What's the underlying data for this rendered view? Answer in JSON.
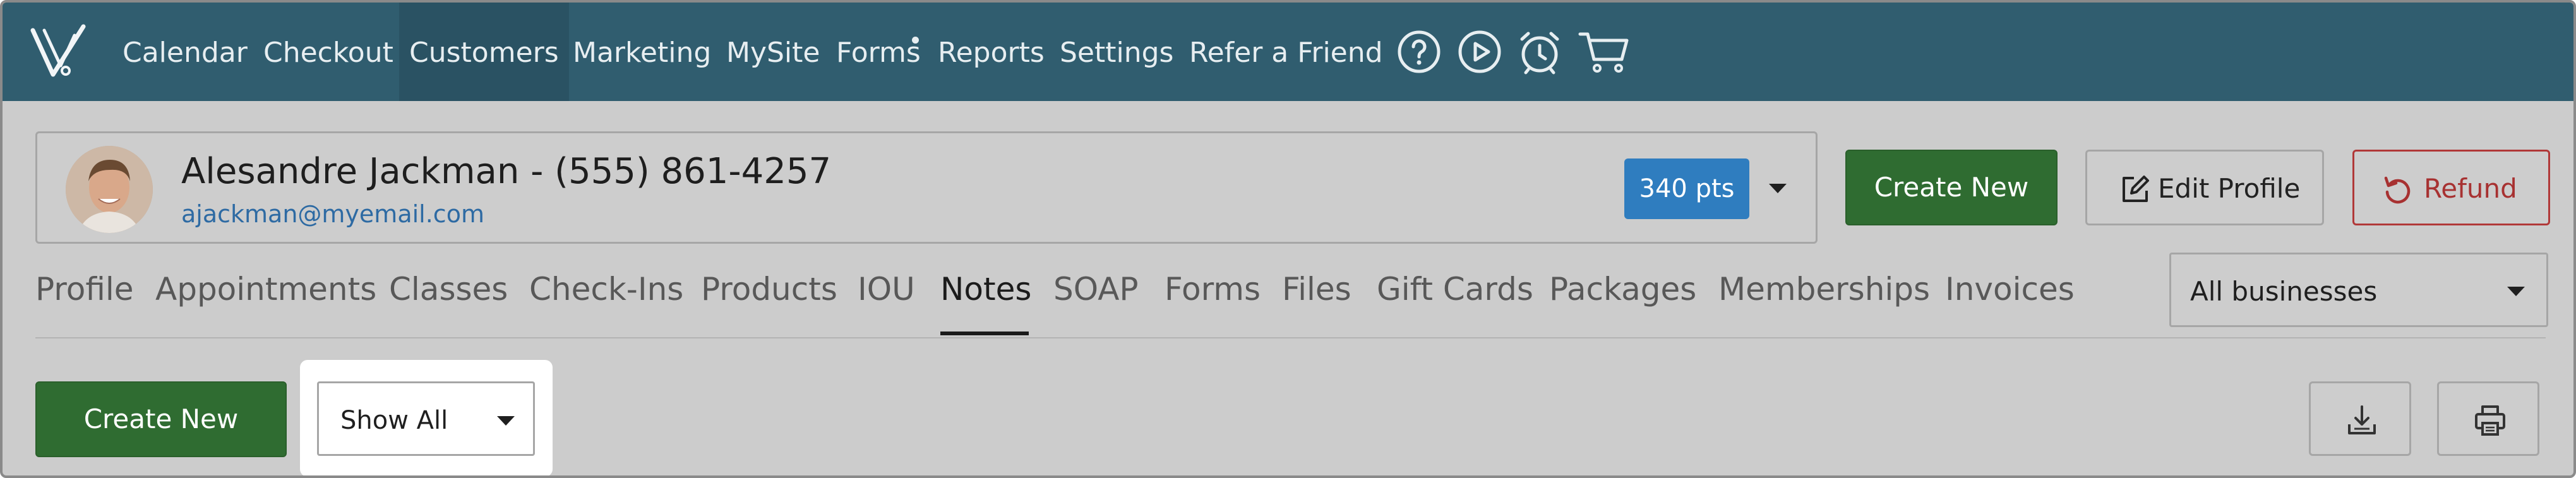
{
  "nav": {
    "items": [
      "Calendar",
      "Checkout",
      "Customers",
      "Marketing",
      "MySite",
      "Forms",
      "Reports",
      "Settings",
      "Refer a Friend"
    ],
    "active": "Customers"
  },
  "icons": [
    "logo-icon",
    "help-icon",
    "play-icon",
    "alarm-clock-icon",
    "cart-icon",
    "edit-icon",
    "refund-icon",
    "download-icon",
    "print-icon"
  ],
  "client": {
    "name": "Alesandre Jackman - (555) 861-4257",
    "email": "ajackman@myemail.com",
    "points": "340 pts"
  },
  "actions": {
    "create_new": "Create New",
    "edit_profile": "Edit Profile",
    "refund": "Refund"
  },
  "tabs": {
    "items": [
      "Profile",
      "Appointments",
      "Classes",
      "Check-Ins",
      "Products",
      "IOU",
      "Notes",
      "SOAP",
      "Forms",
      "Files",
      "Gift Cards",
      "Packages",
      "Memberships",
      "Invoices"
    ],
    "active": "Notes"
  },
  "business_select": {
    "value": "All businesses"
  },
  "notes_toolbar": {
    "create_new": "Create New",
    "filter_value": "Show All"
  },
  "colors": {
    "nav_bg": "#305d6f",
    "green": "#2f6c31",
    "badge_blue": "#2f7dbf",
    "refund_red": "#b13838",
    "link_blue": "#2d6aa3"
  }
}
